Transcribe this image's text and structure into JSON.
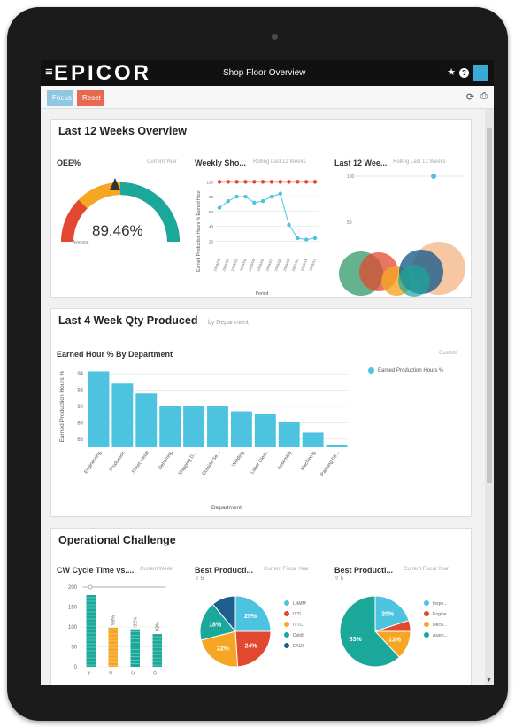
{
  "app": {
    "logo": "EPICOR",
    "title": "Shop Floor Overview"
  },
  "toolbar": {
    "focus_label": "Focus",
    "reset_label": "Reset"
  },
  "panels": {
    "overview": {
      "title": "Last 12 Weeks Overview",
      "oee": {
        "title": "OEE%",
        "meta": "Current Year",
        "value": "89.46%",
        "gauge_label": "Average"
      },
      "weekly": {
        "title": "Weekly Sho...",
        "meta": "Rolling Last 12 Weeks",
        "ylabel": "Earned Production Hours % Earned Hour",
        "xlabel": "Period"
      },
      "last12": {
        "title": "Last 12 Wee...",
        "meta": "Rolling Last 12 Weeks",
        "tick_100": "100",
        "tick_50": "50"
      }
    },
    "qty": {
      "title": "Last 4 Week Qty Produced",
      "subtitle": "by Department",
      "chart_title": "Earned Hour % By Department",
      "chart_meta": "Custom",
      "legend": "Earned Production Hours %"
    },
    "challenge": {
      "title": "Operational Challenge",
      "cw": {
        "title": "CW Cycle Time vs....",
        "meta": "Current Week"
      },
      "bp1": {
        "title": "Best Producti...",
        "meta": "Current Fiscal Year",
        "sub": "5"
      },
      "bp2": {
        "title": "Best Producti...",
        "meta": "Current Fiscal Year",
        "sub": "5"
      }
    }
  },
  "colors": {
    "teal": "#1aa89a",
    "blue": "#4ec3e0",
    "red": "#e2472f",
    "orange": "#f5a623",
    "navy": "#1d5e8c",
    "green": "#4aa57a"
  },
  "chart_data": [
    {
      "type": "bar",
      "title": "Earned Hour % By Department",
      "xlabel": "Department",
      "ylabel": "Earned Production Hours %",
      "categories": [
        "Engineering",
        "Production",
        "Sheet Metal",
        "Deburring",
        "Shipping D...",
        "Outside Se...",
        "Welding",
        "Labor Clean",
        "Assembly",
        "Machining",
        "Painting Dir..."
      ],
      "series": [
        {
          "name": "Earned Production Hours %",
          "values": [
            94.3,
            92.8,
            91.6,
            90.1,
            90.0,
            90.0,
            89.4,
            89.1,
            88.1,
            86.8,
            85.3
          ]
        }
      ],
      "yticks": [
        86,
        88,
        90,
        92,
        94
      ],
      "ylim": [
        85,
        95
      ],
      "legend": "top-right"
    },
    {
      "type": "line",
      "title": "Weekly Sho...",
      "xlabel": "Period",
      "ylabel": "Earned Production Hours % Earned Hour",
      "x": [
        "2019/01",
        "2019/02",
        "2019/03",
        "2019/04",
        "2019/05",
        "2019/06",
        "2019/07",
        "2019/08",
        "2019/09",
        "2019/10",
        "2019/11",
        "2019/12"
      ],
      "series": [
        {
          "values": [
            100,
            100,
            100,
            100,
            100,
            100,
            100,
            100,
            100,
            100,
            100,
            100
          ]
        },
        {
          "values": [
            65,
            74,
            80,
            80,
            72,
            74,
            80,
            84,
            42,
            24,
            22,
            24
          ]
        }
      ],
      "yticks": [
        20,
        40,
        60,
        80,
        100
      ],
      "ylim": [
        0,
        110
      ]
    },
    {
      "type": "bar",
      "title": "CW Cycle Time vs....",
      "categories": [
        "A",
        "B",
        "C",
        "D"
      ],
      "yticks": [
        0,
        50,
        100,
        150,
        200
      ],
      "ylim": [
        0,
        200
      ],
      "series": [
        {
          "values": [
            180,
            98,
            94,
            82
          ]
        }
      ],
      "data_labels": [
        "",
        "98%",
        "92%",
        "93%"
      ]
    },
    {
      "type": "pie",
      "title": "Best Producti...",
      "labels": [
        "LNMM",
        "ITTL",
        "ITTC",
        "Dstrib",
        "EAOI"
      ],
      "values": [
        25,
        24,
        22,
        18,
        11
      ],
      "data_labels": [
        "25%",
        "24%",
        "22%",
        "18%",
        ""
      ]
    },
    {
      "type": "pie",
      "title": "Best Producti...",
      "labels": [
        "Inspe...",
        "Engine...",
        "Deco...",
        "Assm..."
      ],
      "values": [
        20,
        5,
        13,
        62
      ],
      "data_labels": [
        "20%",
        "",
        "13%",
        "63%"
      ]
    }
  ]
}
